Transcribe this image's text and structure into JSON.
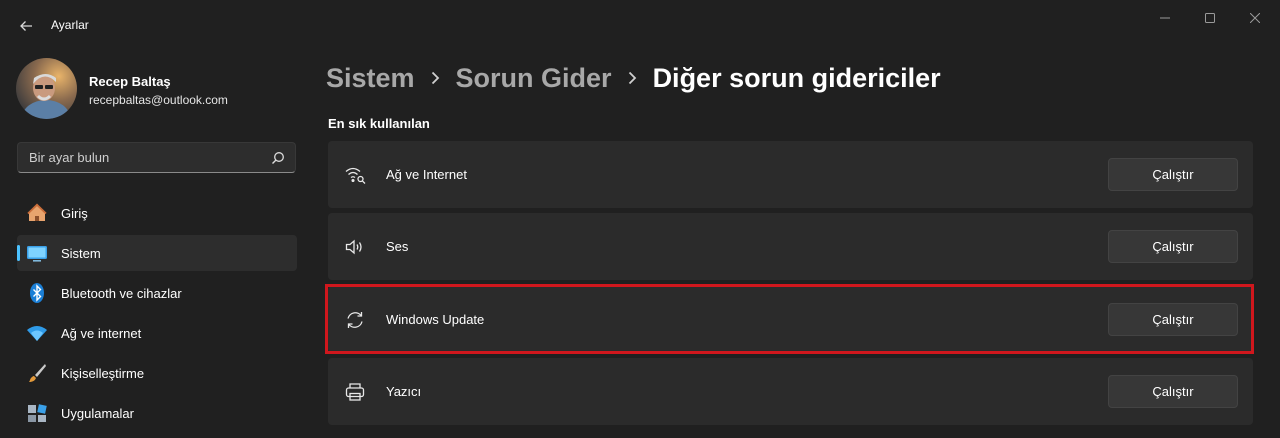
{
  "app": {
    "title": "Ayarlar"
  },
  "user": {
    "name": "Recep Baltaş",
    "email": "recepbaltas@outlook.com"
  },
  "search": {
    "placeholder": "Bir ayar bulun",
    "value": ""
  },
  "sidebar": {
    "items": [
      {
        "label": "Giriş",
        "icon": "home-icon",
        "active": false
      },
      {
        "label": "Sistem",
        "icon": "system-icon",
        "active": true
      },
      {
        "label": "Bluetooth ve cihazlar",
        "icon": "bluetooth-icon",
        "active": false
      },
      {
        "label": "Ağ ve internet",
        "icon": "wifi-icon",
        "active": false
      },
      {
        "label": "Kişiselleştirme",
        "icon": "brush-icon",
        "active": false
      },
      {
        "label": "Uygulamalar",
        "icon": "apps-icon",
        "active": false
      }
    ]
  },
  "breadcrumb": {
    "items": [
      "Sistem",
      "Sorun Gider",
      "Diğer sorun gidericiler"
    ]
  },
  "section": {
    "title": "En sık kullanılan"
  },
  "troubleshooters": [
    {
      "label": "Ağ ve Internet",
      "icon": "network-icon",
      "button": "Çalıştır"
    },
    {
      "label": "Ses",
      "icon": "speaker-icon",
      "button": "Çalıştır"
    },
    {
      "label": "Windows Update",
      "icon": "refresh-icon",
      "button": "Çalıştır",
      "highlighted": true
    },
    {
      "label": "Yazıcı",
      "icon": "printer-icon",
      "button": "Çalıştır"
    }
  ],
  "colors": {
    "accent": "#4cc2ff",
    "highlight": "#d0171d",
    "background": "#202020",
    "card": "#2b2b2b"
  }
}
